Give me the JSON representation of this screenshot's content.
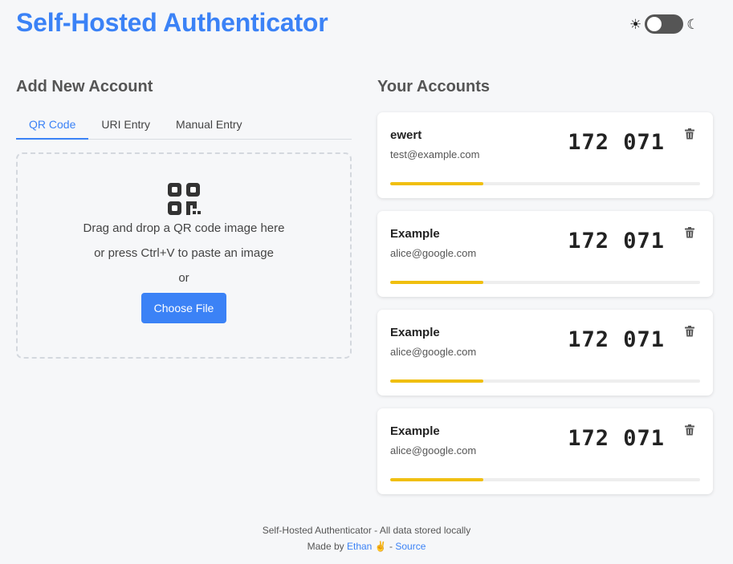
{
  "app": {
    "title": "Self-Hosted Authenticator"
  },
  "theme": {
    "sun_icon": "☀",
    "moon_icon": "☾",
    "dark_mode": false
  },
  "add_section": {
    "title": "Add New Account",
    "tabs": [
      {
        "label": "QR Code",
        "active": true
      },
      {
        "label": "URI Entry",
        "active": false
      },
      {
        "label": "Manual Entry",
        "active": false
      }
    ],
    "drop_text": "Drag and drop a QR code image here",
    "paste_text": "or press Ctrl+V to paste an image",
    "or_text": "or",
    "choose_button": "Choose File"
  },
  "accounts_section": {
    "title": "Your Accounts",
    "accounts": [
      {
        "issuer": "ewert",
        "email": "test@example.com",
        "code": "172 071",
        "progress": 0.3
      },
      {
        "issuer": "Example",
        "email": "alice@google.com",
        "code": "172 071",
        "progress": 0.3
      },
      {
        "issuer": "Example",
        "email": "alice@google.com",
        "code": "172 071",
        "progress": 0.3
      },
      {
        "issuer": "Example",
        "email": "alice@google.com",
        "code": "172 071",
        "progress": 0.3
      }
    ]
  },
  "footer": {
    "line1": "Self-Hosted Authenticator - All data stored locally",
    "made_by": "Made by",
    "author": "Ethan",
    "emoji": "✌️",
    "separator": "-",
    "source": "Source"
  },
  "colors": {
    "accent": "#3b82f6",
    "progress": "#f0bf0f"
  }
}
